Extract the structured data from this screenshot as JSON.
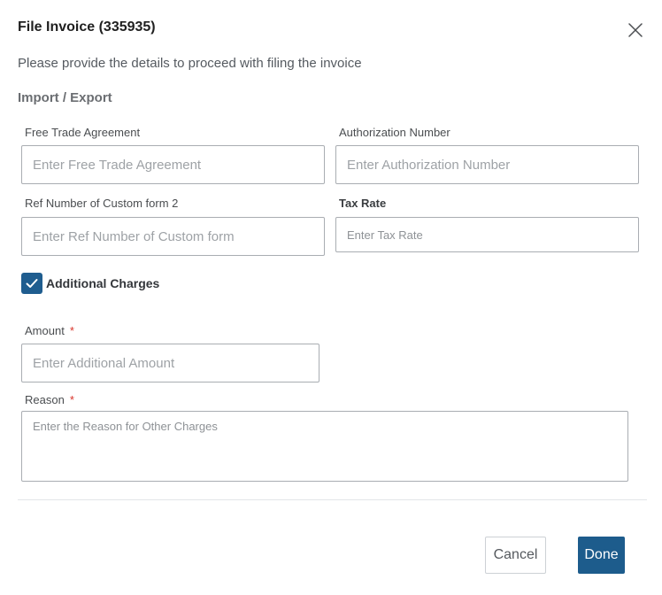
{
  "dialog": {
    "title": "File Invoice (335935)",
    "subtitle": "Please provide the details to proceed with filing the invoice",
    "section_title": "Import / Export"
  },
  "fields": {
    "free_trade": {
      "label": "Free Trade Agreement",
      "placeholder": "Enter Free Trade Agreement",
      "value": ""
    },
    "authorization": {
      "label": "Authorization Number",
      "placeholder": "Enter Authorization Number",
      "value": ""
    },
    "ref_number": {
      "label": "Ref Number of Custom form 2",
      "placeholder": "Enter Ref Number of Custom form",
      "value": ""
    },
    "tax_rate": {
      "label": "Tax Rate",
      "placeholder": "Enter Tax Rate",
      "value": ""
    },
    "additional_charges": {
      "label": "Additional Charges",
      "checked": true
    },
    "amount": {
      "label": "Amount",
      "required_mark": "*",
      "placeholder": "Enter Additional Amount",
      "value": ""
    },
    "reason": {
      "label": "Reason",
      "required_mark": "*",
      "placeholder": "Enter the Reason for Other Charges",
      "value": ""
    }
  },
  "actions": {
    "cancel_label": "Cancel",
    "done_label": "Done"
  },
  "icons": {
    "close": "close-icon",
    "check": "checkmark-icon"
  },
  "colors": {
    "primary": "#1d5c8c",
    "required": "#d9342b"
  }
}
